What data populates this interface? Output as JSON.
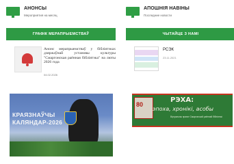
{
  "left_section": {
    "title": "АНОНСЫ",
    "subtitle": "Мероприятия на месяц",
    "button_label": "ГРАФІК МЕРАПРЫЕМСТВАЎ",
    "item": {
      "text": "Анонс мерапрыемстваў у бібліятэках дзяржаўнай установы культуры \"Смаргонская раённая бібліятэка\" на люты 2026 года",
      "date": "04.02.2026",
      "icon": "bell-icon"
    }
  },
  "right_section": {
    "title": "АПОШНІЯ НАВІНЫ",
    "subtitle": "Последние новости",
    "button_label": "ЧЫТАЙЦЕ З НАМІ",
    "item": {
      "title": "РСЭК",
      "date": "23.11.2021"
    }
  },
  "banners": {
    "left": {
      "line1": "КРАЯЗНАЎЧЫ",
      "line2": "КАЛЯНДАР-2026"
    },
    "right": {
      "badge": "80",
      "main": "РЭХА:",
      "sub": "эпоха, хронікі, асобы",
      "tiny": "Віртуальны праект Смаргонскай раённай бібліятэкі"
    }
  },
  "colors": {
    "accent": "#2e9a44",
    "banner_red": "#c7331f"
  }
}
